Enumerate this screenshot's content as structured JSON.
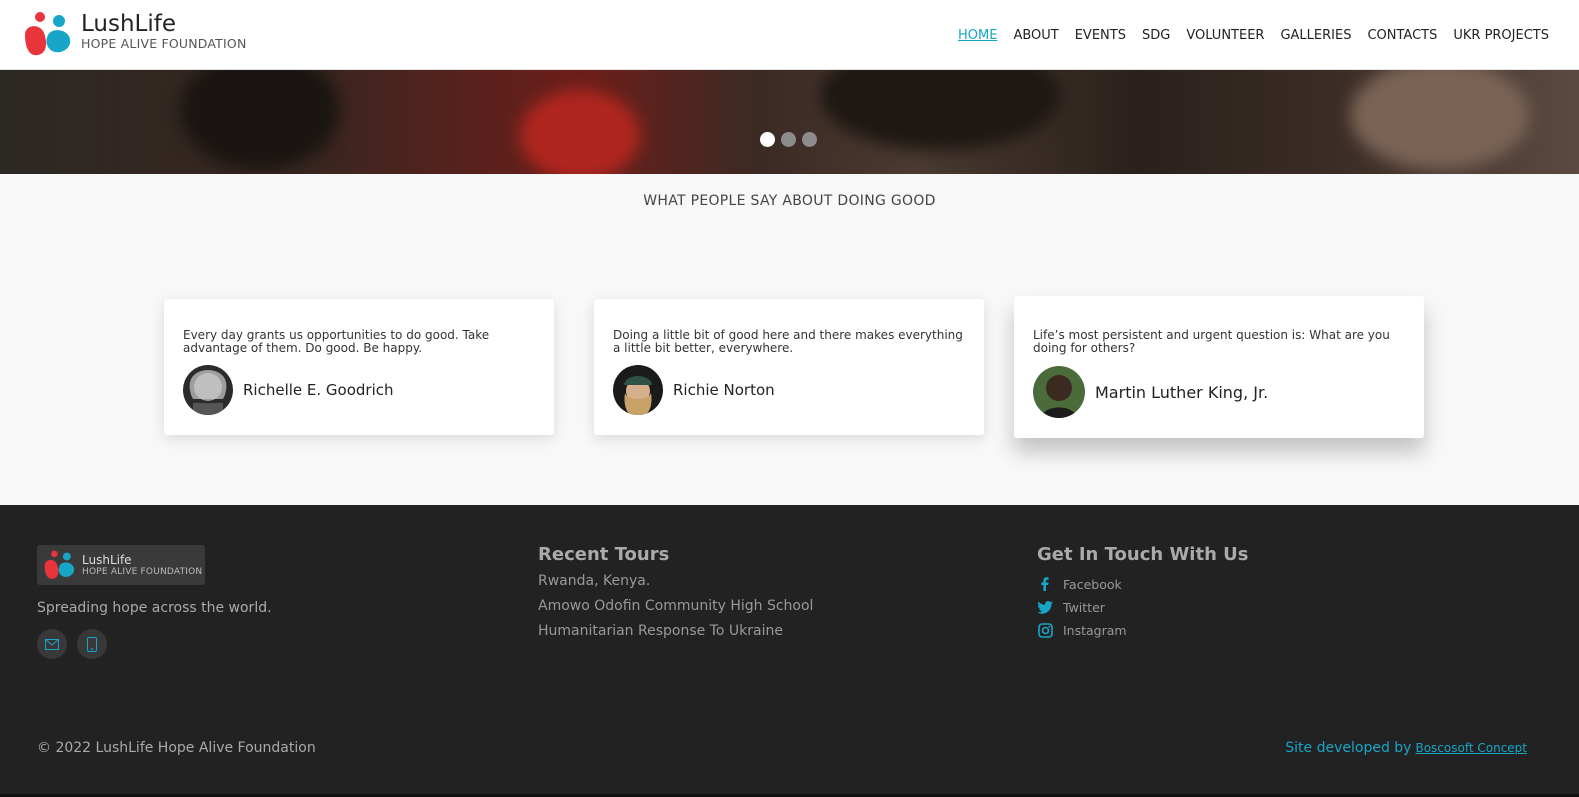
{
  "header": {
    "brand_title": "LushLife",
    "brand_subtitle": "HOPE ALIVE FOUNDATION",
    "nav": [
      {
        "label": "HOME",
        "active": true
      },
      {
        "label": "ABOUT"
      },
      {
        "label": "EVENTS"
      },
      {
        "label": "SDG"
      },
      {
        "label": "VOLUNTEER"
      },
      {
        "label": "GALLERIES"
      },
      {
        "label": "CONTACTS"
      },
      {
        "label": "UKR PROJECTS"
      }
    ]
  },
  "hero": {
    "slides": 3,
    "active_slide": 1
  },
  "testimonials": {
    "title": "WHAT PEOPLE SAY ABOUT DOING GOOD",
    "items": [
      {
        "quote": "Every day grants us opportunities to do good. Take advantage of them. Do good. Be happy.",
        "author": "Richelle E. Goodrich"
      },
      {
        "quote": "Doing a little bit of good here and there makes everything a little bit better, everywhere.",
        "author": "Richie Norton"
      },
      {
        "quote": "Life’s most persistent and urgent question is: What are you doing for others?",
        "author": "Martin Luther King, Jr."
      }
    ]
  },
  "footer": {
    "brand_title": "LushLife",
    "brand_subtitle": "HOPE ALIVE FOUNDATION",
    "tagline": "Spreading hope across the world.",
    "contact_icons": [
      "envelope-icon",
      "mobile-phone-icon"
    ],
    "tours_title": "Recent Tours",
    "tours": [
      "Rwanda, Kenya.",
      "Amowo Odofin Community High School",
      "Humanitarian Response To Ukraine"
    ],
    "contact_title": "Get In Touch With Us",
    "social": [
      {
        "label": "Facebook",
        "icon": "facebook-icon"
      },
      {
        "label": "Twitter",
        "icon": "twitter-icon"
      },
      {
        "label": "Instagram",
        "icon": "instagram-icon"
      }
    ],
    "copyright": "© 2022 LushLife Hope Alive Foundation",
    "developed_by": "Site developed by",
    "developer": "Boscosoft Concept"
  },
  "colors": {
    "accent": "#17a6c7",
    "logo_red": "#e8343a",
    "footer_bg": "#222222"
  }
}
